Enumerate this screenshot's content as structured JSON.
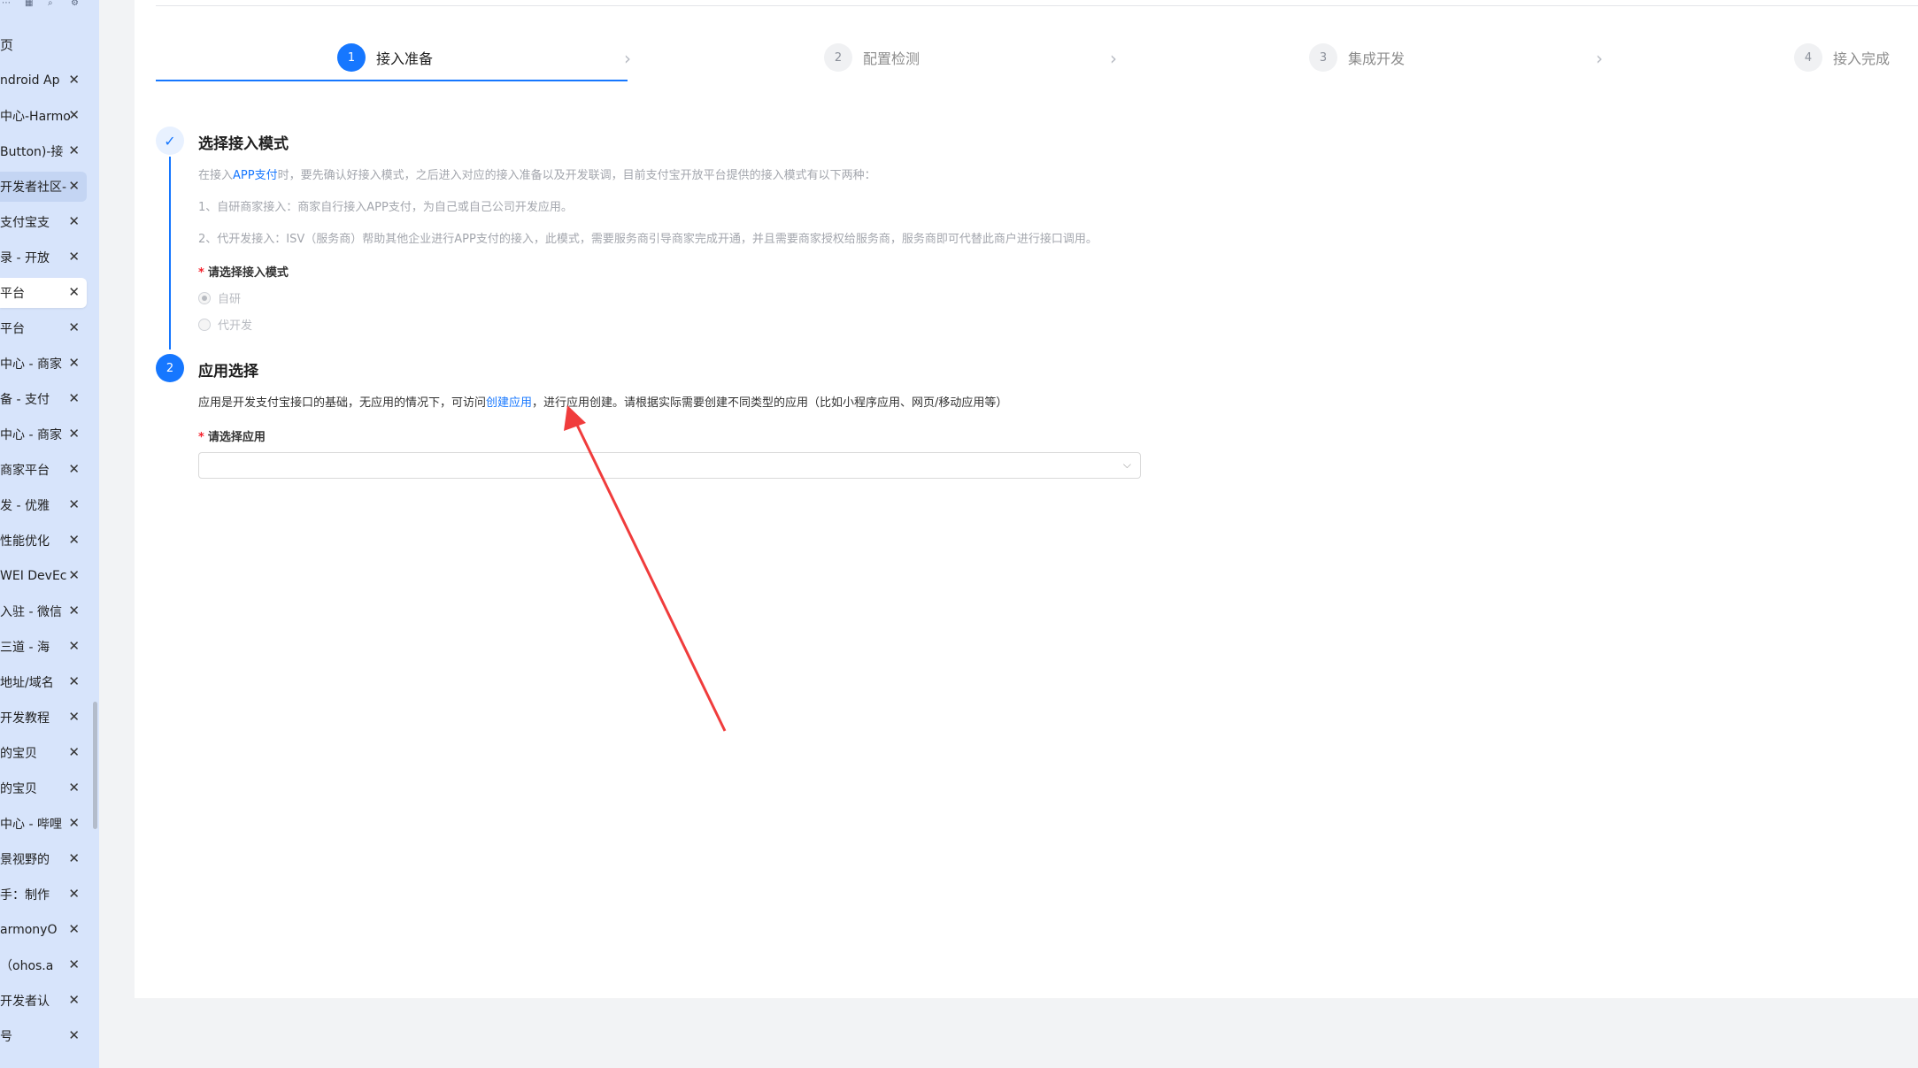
{
  "tabstrip": {
    "home_label": "页",
    "close_glyph": "✕",
    "tabs": [
      {
        "label": "ndroid Ap"
      },
      {
        "label": "中心-Harmo"
      },
      {
        "label": "Button)-接"
      },
      {
        "label": "开发者社区-"
      },
      {
        "label": "支付宝支"
      },
      {
        "label": "录 - 开放"
      },
      {
        "label": "平台"
      },
      {
        "label": "平台"
      },
      {
        "label": "中心 - 商家"
      },
      {
        "label": "备 - 支付"
      },
      {
        "label": "中心 - 商家"
      },
      {
        "label": "商家平台"
      },
      {
        "label": "发 - 优雅"
      },
      {
        "label": "性能优化"
      },
      {
        "label": "WEI DevEc"
      },
      {
        "label": "入驻 - 微信"
      },
      {
        "label": "三道 - 海"
      },
      {
        "label": "地址/域名"
      },
      {
        "label": "开发教程"
      },
      {
        "label": "的宝贝"
      },
      {
        "label": "的宝贝"
      },
      {
        "label": "中心 - 哔哩"
      },
      {
        "label": "景视野的"
      },
      {
        "label": "手：制作"
      },
      {
        "label": "armonyO"
      },
      {
        "label": "（ohos.a"
      },
      {
        "label": "开发者认"
      },
      {
        "label": "号"
      }
    ]
  },
  "steps": [
    {
      "num": "1",
      "label": "接入准备"
    },
    {
      "num": "2",
      "label": "配置检测"
    },
    {
      "num": "3",
      "label": "集成开发"
    },
    {
      "num": "4",
      "label": "接入完成"
    }
  ],
  "section1": {
    "title": "选择接入模式",
    "desc_prefix": "在接入",
    "desc_link": "APP支付",
    "desc_suffix": "时，要先确认好接入模式，之后进入对应的接入准备以及开发联调，目前支付宝开放平台提供的接入模式有以下两种：",
    "line1": "1、自研商家接入：商家自行接入APP支付，为自己或自己公司开发应用。",
    "line2": "2、代开发接入：ISV（服务商）帮助其他企业进行APP支付的接入，此模式，需要服务商引导商家完成开通，并且需要商家授权给服务商，服务商即可代替此商户进行接口调用。",
    "field_label": "请选择接入模式",
    "required_mark": "*",
    "option_self": "自研",
    "option_agent": "代开发"
  },
  "section2": {
    "num": "2",
    "title": "应用选择",
    "desc_prefix": "应用是开发支付宝接口的基础，无应用的情况下，可访问",
    "desc_link": "创建应用",
    "desc_suffix": "，进行应用创建。请根据实际需要创建不同类型的应用（比如小程序应用、网页/移动应用等）",
    "field_label": "请选择应用",
    "required_mark": "*",
    "select_value": ""
  },
  "colors": {
    "accent": "#1677ff",
    "annotation_arrow": "#f03c3c",
    "tabstrip_bg": "#d7e4fb"
  }
}
